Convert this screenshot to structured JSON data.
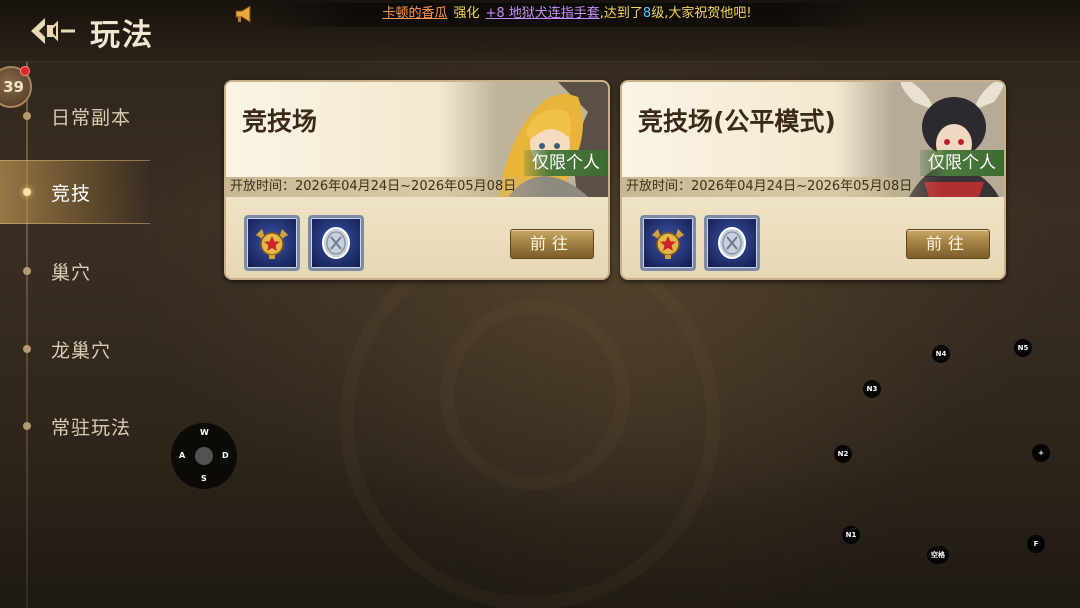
{
  "header": {
    "title": "玩法",
    "broadcast": {
      "player": "卡顿的香瓜",
      "action": "强化",
      "item": "+8 地狱犬连指手套",
      "middle": ",达到了",
      "level": "8",
      "suffix": "级,大家祝贺他吧!"
    }
  },
  "sidebar": {
    "badge": "39",
    "items": [
      {
        "label": "日常副本",
        "active": false
      },
      {
        "label": "竞技",
        "active": true
      },
      {
        "label": "巢穴",
        "active": false
      },
      {
        "label": "龙巢穴",
        "active": false
      },
      {
        "label": "常驻玩法",
        "active": false
      }
    ]
  },
  "cards": [
    {
      "title": "竞技场",
      "tag": "仅限个人",
      "time": "开放时间：2026年04月24日~2026年05月08日",
      "button": "前往"
    },
    {
      "title": "竞技场(公平模式)",
      "tag": "仅限个人",
      "time": "开放时间：2026年04月24日~2026年05月08日",
      "button": "前往"
    }
  ],
  "overlay": {
    "joystick": {
      "up": "W",
      "left": "A",
      "right": "D",
      "down": "S"
    },
    "keys": {
      "n1": "N1",
      "n2": "N2",
      "n3": "N3",
      "n4": "N4",
      "n5": "N5",
      "plus": "+",
      "f": "F",
      "space": "空格"
    }
  },
  "colors": {
    "accent_gold": "#c9a766",
    "tag_green": "#4d7a3e",
    "notice_red": "#e0282a"
  }
}
